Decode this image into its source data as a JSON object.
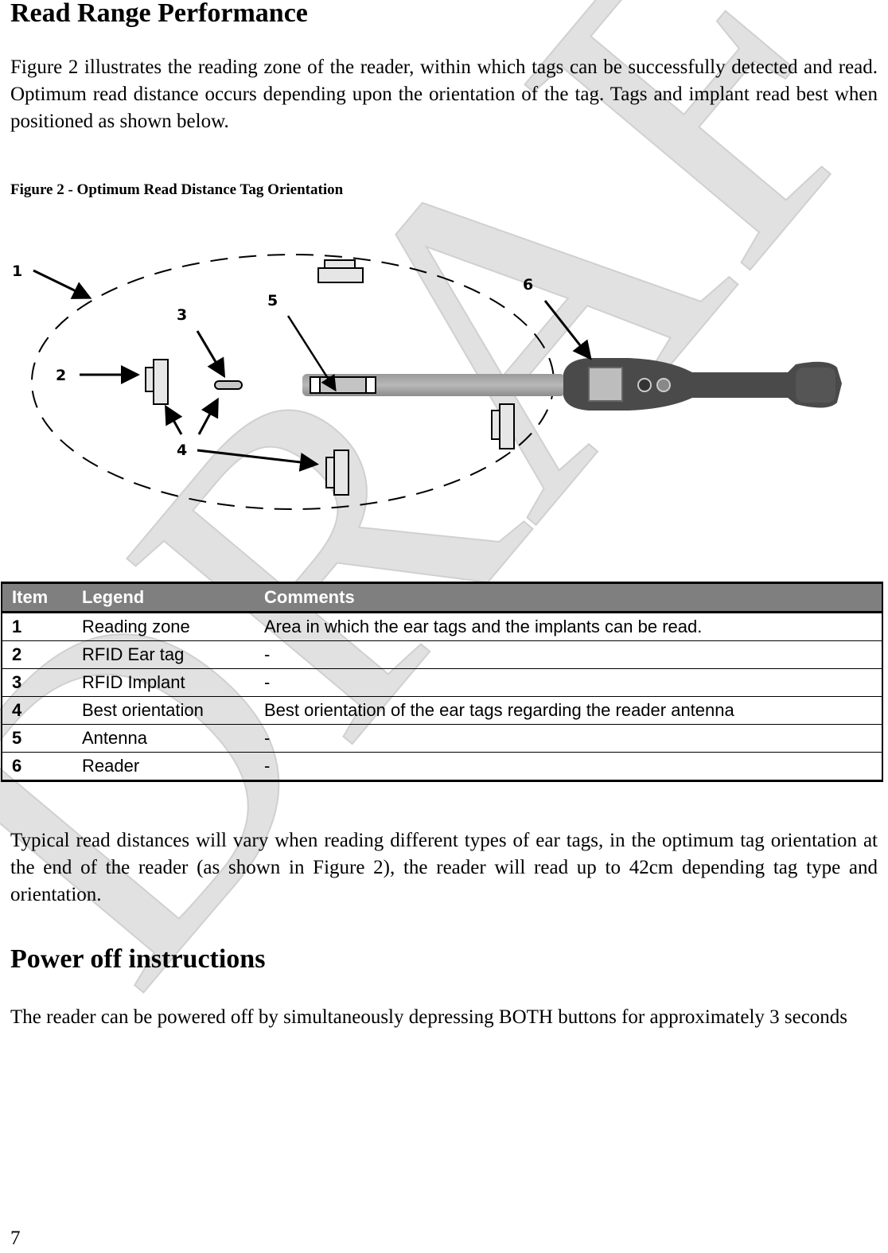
{
  "section1": {
    "heading": "Read Range Performance",
    "paragraph": "Figure 2 illustrates the reading zone of the reader, within which tags can be successfully detected and read. Optimum read distance occurs depending upon the orientation of the tag. Tags and implant read best when positioned as shown below."
  },
  "figure": {
    "caption": "Figure 2 - Optimum Read Distance Tag Orientation",
    "callouts": [
      "1",
      "2",
      "3",
      "4",
      "5",
      "6"
    ]
  },
  "legend_table": {
    "headers": [
      "Item",
      "Legend",
      "Comments"
    ],
    "rows": [
      {
        "item": "1",
        "legend": "Reading zone",
        "comment": "Area in which the ear tags and the implants can be read."
      },
      {
        "item": "2",
        "legend": "RFID Ear tag",
        "comment": "-"
      },
      {
        "item": "3",
        "legend": "RFID Implant",
        "comment": "-"
      },
      {
        "item": "4",
        "legend": "Best orientation",
        "comment": "Best orientation of the ear tags regarding the reader antenna"
      },
      {
        "item": "5",
        "legend": "Antenna",
        "comment": "-"
      },
      {
        "item": "6",
        "legend": "Reader",
        "comment": "-"
      }
    ],
    "header_bg": "#7f7f7f"
  },
  "read_distance_paragraph": "Typical read distances will vary when reading different types of ear tags, in the optimum tag orientation at the end of the reader (as shown in Figure 2), the reader will read up to 42cm depending tag type and orientation.",
  "section2": {
    "heading": "Power off instructions",
    "paragraph": "The reader can be powered off by simultaneously depressing BOTH buttons for approximately 3 seconds"
  },
  "watermark_text": "DRAFT",
  "page_number": "7"
}
